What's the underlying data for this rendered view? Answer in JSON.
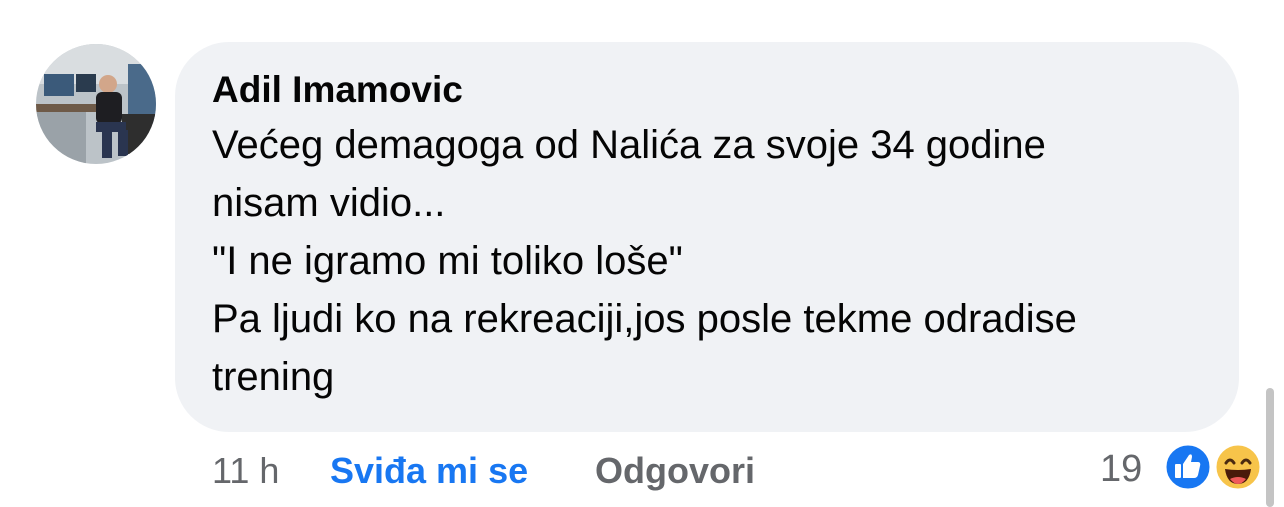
{
  "comment": {
    "author": "Adil Imamovic",
    "lines": [
      "Većeg demagoga od Nalića za svoje 34 godine",
      "nisam vidio...",
      "\"I ne igramo mi toliko loše\"",
      "Pa ljudi ko na rekreaciji,jos posle tekme odradise",
      "trening"
    ],
    "time": "11 h",
    "like_label": "Sviđa mi se",
    "reply_label": "Odgovori",
    "reaction_count": "19",
    "reactions": [
      "like-icon",
      "haha-icon"
    ]
  },
  "colors": {
    "bubble": "#f0f2f5",
    "text": "#050505",
    "muted": "#65676b",
    "accent": "#1877f2"
  }
}
